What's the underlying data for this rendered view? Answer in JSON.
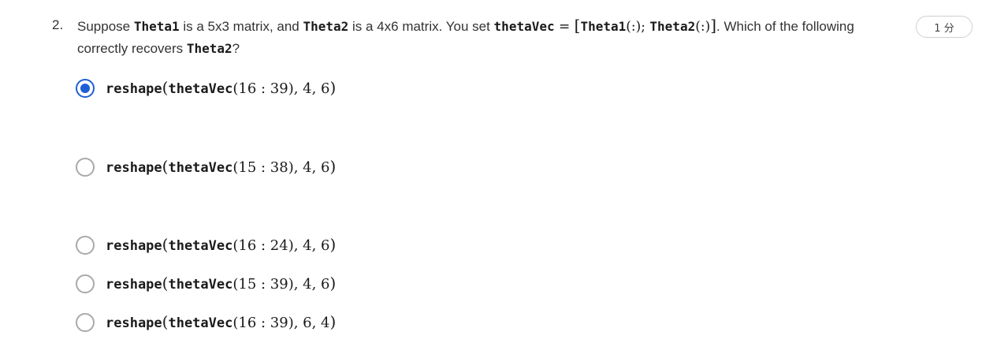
{
  "question": {
    "number": "2.",
    "text_1": "Suppose ",
    "code_theta1": "Theta1",
    "text_2": " is a 5x3 matrix, and ",
    "code_theta2": "Theta2",
    "text_3": " is a 4x6 matrix. You set ",
    "code_thetavec": "thetaVec",
    "math_eq": " = ",
    "bracket_open": "[",
    "math_theta1_colon": "Theta1",
    "math_paren_part1": "(:); ",
    "math_theta2_colon": "Theta2",
    "math_paren_part2": "(:)",
    "bracket_close": "]",
    "text_4": ". Which of the following correctly recovers ",
    "code_theta2_end": "Theta2",
    "text_5": "?"
  },
  "points_badge": "1 分",
  "options": [
    {
      "fn": "reshape",
      "open": "(",
      "inner_fn": "thetaVec",
      "range": "(16 : 39), 4, 6",
      "close": ")",
      "checked": true
    },
    {
      "fn": "reshape",
      "open": "(",
      "inner_fn": "thetaVec",
      "range": "(15 : 38), 4, 6",
      "close": ")",
      "checked": false
    },
    {
      "fn": "reshape",
      "open": "(",
      "inner_fn": "thetaVec",
      "range": "(16 : 24), 4, 6",
      "close": ")",
      "checked": false
    },
    {
      "fn": "reshape",
      "open": "(",
      "inner_fn": "thetaVec",
      "range": "(15 : 39), 4, 6",
      "close": ")",
      "checked": false
    },
    {
      "fn": "reshape",
      "open": "(",
      "inner_fn": "thetaVec",
      "range": "(16 : 39), 6, 4",
      "close": ")",
      "checked": false
    }
  ],
  "colors": {
    "selected_radio": "#1f5fd6",
    "unselected_radio_border": "#a9a9a9",
    "badge_border": "#d0d0d0"
  }
}
